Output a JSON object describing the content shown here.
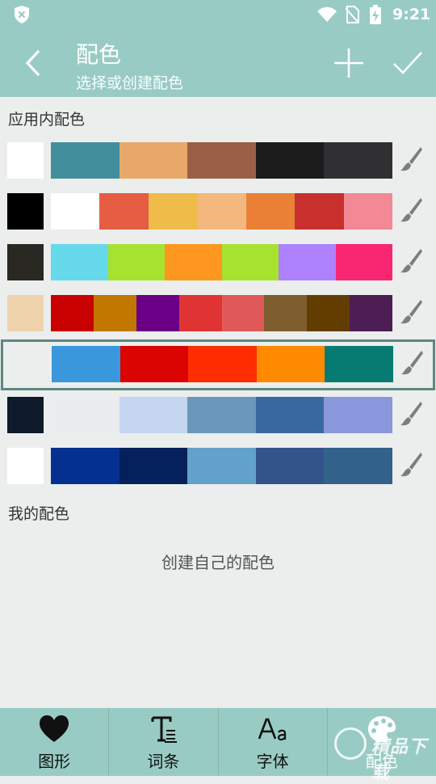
{
  "status_bar": {
    "time": "9:21"
  },
  "app_bar": {
    "title": "配色",
    "subtitle": "选择或创建配色"
  },
  "sections": {
    "builtin_label": "应用内配色",
    "mine_label": "我的配色"
  },
  "palettes": [
    {
      "single": "#ffffff",
      "colors": [
        "#438e9c",
        "#e7a86a",
        "#9a5f45",
        "#1c1b1c",
        "#303032"
      ]
    },
    {
      "single": "#000000",
      "colors": [
        "#ffffff",
        "#e55d43",
        "#efbb49",
        "#f3b87d",
        "#ea8137",
        "#c8302d",
        "#f38994"
      ]
    },
    {
      "single": "#292822",
      "colors": [
        "#66d9eb",
        "#a7e22f",
        "#fe971f",
        "#a7e22f",
        "#ad81ff",
        "#f92672"
      ]
    },
    {
      "single": "#efd3ad",
      "colors": [
        "#c90000",
        "#c27700",
        "#6b0086",
        "#e03434",
        "#e15a5a",
        "#7e5d2e",
        "#633d00",
        "#4c1e53"
      ]
    },
    {
      "single": "#ebeeed",
      "colors": [
        "#3a97dc",
        "#dc0303",
        "#ff2d01",
        "#ff8a00",
        "#077b71"
      ],
      "selected": true
    },
    {
      "single": "#0d1b2c",
      "colors": [
        "#ebecf0",
        "#c4d6f0",
        "#6b97ba",
        "#3869a1",
        "#8b97dc"
      ]
    },
    {
      "single": "#ffffff",
      "colors": [
        "#04308f",
        "#05215c",
        "#62a2ca",
        "#32548a",
        "#326289"
      ]
    }
  ],
  "empty_state": {
    "text": "创建自己的配色"
  },
  "bottom_nav": [
    {
      "label": "图形",
      "icon": "heart-icon"
    },
    {
      "label": "词条",
      "icon": "text-icon"
    },
    {
      "label": "字体",
      "icon": "font-icon"
    },
    {
      "label": "配色",
      "icon": "palette-icon"
    }
  ],
  "watermark": {
    "text": "精品下载"
  },
  "colors": {
    "accent": "#98cbc4",
    "background": "#ebeeed",
    "selected_border": "#5d8781"
  }
}
